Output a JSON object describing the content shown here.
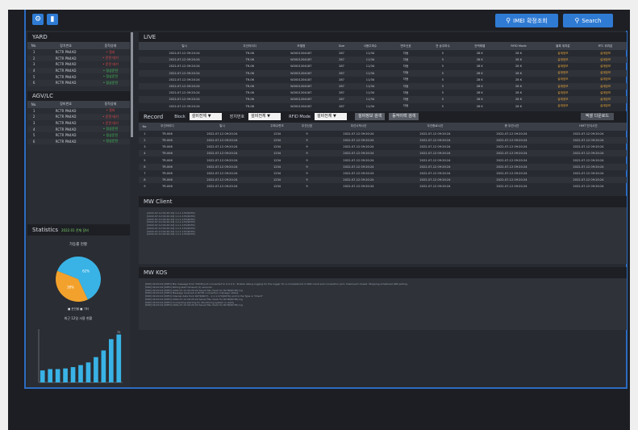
{
  "topbar": {
    "buttons": [
      {
        "label": "IMEI 확정조회"
      },
      {
        "label": "Search"
      }
    ]
  },
  "yard": {
    "title": "YARD",
    "columns": [
      "No.",
      "장치번호",
      "동작상태"
    ],
    "rows": [
      [
        "1",
        "RCTR PN4AD",
        "• 정지",
        "red"
      ],
      [
        "2",
        "RCTR PN4AD",
        "• 운전 대기",
        "red"
      ],
      [
        "3",
        "RCTR PN4AD",
        "• 운전 대기",
        "red"
      ],
      [
        "4",
        "RCTR PN4AD",
        "• 정상운전",
        "green"
      ],
      [
        "5",
        "RCTR PN4AD",
        "• 정상운전",
        "green"
      ],
      [
        "6",
        "RCTR PN4AD",
        "• 정상운전",
        "green"
      ]
    ]
  },
  "agv": {
    "title": "AGV/LC",
    "columns": [
      "No.",
      "장비번호",
      "동작상태"
    ],
    "rows": [
      [
        "1",
        "RCTR PN4AD",
        "• 정지",
        "red"
      ],
      [
        "2",
        "RCTR PN4AD",
        "• 운전 대기",
        "red"
      ],
      [
        "3",
        "RCTR PN4AD",
        "• 운전 대기",
        "red"
      ],
      [
        "4",
        "RCTR PN4AD",
        "• 정상운전",
        "green"
      ],
      [
        "5",
        "RCTR PN4AD",
        "• 정상운전",
        "green"
      ],
      [
        "6",
        "RCTR PN4AD",
        "• 정상운전",
        "green"
      ]
    ]
  },
  "statistics": {
    "title": "Statistics",
    "subtitle": "2022.01 전체 장비",
    "pie_title": "가동률 현황",
    "pie_slices": [
      {
        "label": "62%",
        "value": 62,
        "color": "#39b3e6"
      },
      {
        "label": "38%",
        "value": 38,
        "color": "#f2a22c"
      }
    ],
    "pie_legend": "■ 운전율  ■ 기타",
    "bar_title": "최근 12일 사용 현황",
    "bar_values": [
      18,
      20,
      20,
      21,
      23,
      26,
      30,
      38,
      48,
      65,
      72
    ],
    "bar_labels": [
      "",
      "",
      "",
      "",
      "",
      "",
      "",
      "",
      "",
      "",
      "72"
    ]
  },
  "live": {
    "title": "LIVE",
    "columns": [
      "일시",
      "무선아이디",
      "모델명",
      "Size",
      "사용주파수",
      "변조신호",
      "전 송주파수",
      "전력레벨",
      "RFID Mode",
      "블록 위치값",
      "RTC 위치값"
    ],
    "rows": [
      [
        "2022-07-12 09:20:24",
        "TR-06",
        "W2001204187",
        "287",
        "11/34",
        "자동",
        "5",
        "28 K",
        "28 K",
        "설계정보",
        "설계정보"
      ],
      [
        "2022-07-12 09:20:24",
        "TR-06",
        "W2001204187",
        "287",
        "11/34",
        "자동",
        "5",
        "28 K",
        "28 K",
        "설계정보",
        "설계정보"
      ],
      [
        "2022-07-12 09:20:24",
        "TR-06",
        "W2001204187",
        "287",
        "11/34",
        "자동",
        "5",
        "28 K",
        "28 K",
        "설계정보",
        "설계정보"
      ],
      [
        "2022-07-12 09:20:24",
        "TR-06",
        "W2001204187",
        "287",
        "11/34",
        "자동",
        "5",
        "28 K",
        "28 K",
        "설계정보",
        "설계정보"
      ],
      [
        "2022-07-12 09:20:24",
        "TR-06",
        "W2001204187",
        "287",
        "11/34",
        "자동",
        "5",
        "28 K",
        "28 K",
        "설계정보",
        "설계정보"
      ],
      [
        "2022-07-12 09:20:24",
        "TR-06",
        "W2001204187",
        "287",
        "11/34",
        "자동",
        "5",
        "28 K",
        "28 K",
        "설계정보",
        "설계정보"
      ],
      [
        "2022-07-12 09:20:24",
        "TR-06",
        "W2001204187",
        "287",
        "11/34",
        "자동",
        "5",
        "28 K",
        "28 K",
        "설계정보",
        "설계정보"
      ],
      [
        "2022-07-12 09:20:24",
        "TR-06",
        "W2001204187",
        "287",
        "11/34",
        "자동",
        "5",
        "28 K",
        "28 K",
        "설계정보",
        "설계정보"
      ],
      [
        "2022-07-12 09:20:24",
        "TR-06",
        "W2001204187",
        "287",
        "11/34",
        "자동",
        "5",
        "28 K",
        "28 K",
        "설계정보",
        "설계정보"
      ]
    ]
  },
  "record": {
    "title": "Record",
    "filter1_label": "Block",
    "filter1_value": "설비전체 ▼",
    "filter2_label": "장치번호",
    "filter2_value": "설비전체 ▼",
    "filter3_label": "RFID Mode",
    "filter3_value": "설비전체 ▼",
    "btn1": "설비정보 검색",
    "btn2": "동작이력 검색",
    "download": "엑셀 다운로드",
    "columns": [
      "No.",
      "무선아이디",
      "일시",
      "주파수변조",
      "무선신호",
      "무선시작시간",
      "무선종료시간",
      "총 무선시간",
      "HMT 인식시간"
    ],
    "rows": [
      [
        "1",
        "TR-006",
        "2022-07-12 09:20:24",
        "1234",
        "9",
        "2022-07-12 09:20:24",
        "2022-07-12 09:20:24",
        "2022-07-12 09:20:24",
        "2022-07-12 09:20:24"
      ],
      [
        "2",
        "TR-006",
        "2022-07-12 09:20:24",
        "1234",
        "9",
        "2022-07-12 09:20:24",
        "2022-07-12 09:20:24",
        "2022-07-12 09:20:24",
        "2022-07-12 09:20:24"
      ],
      [
        "3",
        "TR-006",
        "2022-07-12 09:20:24",
        "1234",
        "9",
        "2022-07-12 09:20:24",
        "2022-07-12 09:20:24",
        "2022-07-12 09:20:24",
        "2022-07-12 09:20:24"
      ],
      [
        "4",
        "TR-006",
        "2022-07-12 09:20:24",
        "1234",
        "9",
        "2022-07-12 09:20:24",
        "2022-07-12 09:20:24",
        "2022-07-12 09:20:24",
        "2022-07-12 09:20:24"
      ],
      [
        "5",
        "TR-006",
        "2022-07-12 09:20:24",
        "1234",
        "9",
        "2022-07-12 09:20:24",
        "2022-07-12 09:20:24",
        "2022-07-12 09:20:24",
        "2022-07-12 09:20:24"
      ],
      [
        "6",
        "TR-006",
        "2022-07-12 09:20:24",
        "1234",
        "9",
        "2022-07-12 09:20:24",
        "2022-07-12 09:20:24",
        "2022-07-12 09:20:24",
        "2022-07-12 09:20:24"
      ],
      [
        "7",
        "TR-006",
        "2022-07-12 09:20:24",
        "1234",
        "9",
        "2022-07-12 09:20:24",
        "2022-07-12 09:20:24",
        "2022-07-12 09:20:24",
        "2022-07-12 09:20:24"
      ],
      [
        "8",
        "TR-006",
        "2022-07-12 09:20:24",
        "1234",
        "9",
        "2022-07-12 09:20:24",
        "2022-07-12 09:20:24",
        "2022-07-12 09:20:24",
        "2022-07-12 09:20:24"
      ],
      [
        "9",
        "TR-006",
        "2022-07-12 09:20:24",
        "1234",
        "9",
        "2022-07-12 09:20:24",
        "2022-07-12 09:20:24",
        "2022-07-12 09:20:24",
        "2022-07-12 09:20:24"
      ]
    ]
  },
  "mw_client": {
    "title": "MW Client",
    "lines": [
      "[2022-07-12 09:20:24] 1.1.1.170(RCTR)",
      "[2022-07-12 09:20:24] 1.1.1.170(RCTR)",
      "[2022-07-12 09:20:24] 1.1.1.170(RCTR)",
      "[2022-07-12 09:20:24] 1.1.1.170(RCTR)",
      "[2022-07-12 09:20:24] 1.1.1.170(RCTR)",
      "[2022-07-12 09:20:24] 1.1.1.170(RCTR)",
      "[2022-07-12 09:20:24] 1.1.1.170(RCTR)",
      "[2022-07-12 09:20:24] 1.1.1.170(RCTR)"
    ]
  },
  "mw_kos": {
    "title": "MW KOS",
    "lines": [
      "[MW] 09:20:24 [INFO] Mw message from TCP/IP port connected to 0.0.0.0 - Enable debug logging for the logger for a complete list of LRR client and connection port. Client port closed. Stopping scheduled LRR polling.",
      "[MW] 09:20:24 [INFO] Polling start timeout (1) seconds",
      "[MW] 09:20:24 [INFO] 2022-07-12 09:20:24 Saved file check for RCTR(RCTR) log",
      "[MW] 09:20:24 [INFO] Message received in RCTR connection manager status",
      "[MW] 09:20:24 [INFO] Internal data from RCTR(NCT) - 1.1.1.170(RCTR) and to the Type is \"Client\"",
      "[MW] 09:20:24 [INFO] 2022-07-12 09:20:24 Saved file check for RCTR(RCTR) log",
      "[MW] 09:20:24 [INFO] Connecting starting for Monitoring system is ready",
      "[MW] 09:20:24 [INFO] 2022-07-12 09:20:24 Saved file check for RCTR(RCTR) log"
    ]
  }
}
